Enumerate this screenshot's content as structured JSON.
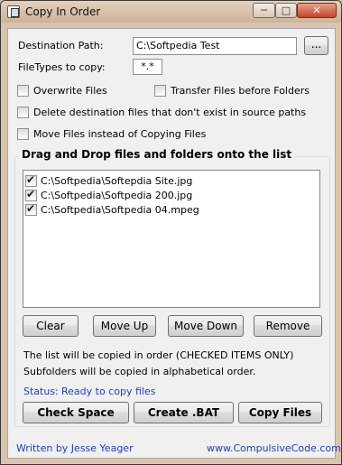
{
  "window": {
    "title": "Copy In Order",
    "minimize_glyph": "─",
    "maximize_glyph": "□",
    "close_glyph": "✕"
  },
  "destination": {
    "label": "Destination Path:",
    "value": "C:\\Softpedia Test",
    "browse_label": "..."
  },
  "filetypes": {
    "label": "FileTypes to copy:",
    "value": "*.*"
  },
  "options": {
    "overwrite": {
      "label": "Overwrite Files",
      "checked": false
    },
    "transfer_before_folders": {
      "label": "Transfer Files before Folders",
      "checked": false
    },
    "delete_destination": {
      "label": "Delete destination files that don't exist in source paths",
      "checked": false
    },
    "move_files": {
      "label": "Move Files instead of Copying Files",
      "checked": false
    }
  },
  "dropgroup": {
    "title": "Drag and Drop files and folders onto the list",
    "items": [
      {
        "path": "C:\\Softpedia\\Softepdia Site.jpg",
        "checked": true
      },
      {
        "path": "C:\\Softpedia\\Softpedia 200.jpg",
        "checked": true
      },
      {
        "path": "C:\\Softpedia\\Softpedia 04.mpeg",
        "checked": true
      }
    ],
    "buttons": {
      "clear": "Clear",
      "move_up": "Move Up",
      "move_down": "Move Down",
      "remove": "Remove"
    },
    "note1": "The list will be copied in order (CHECKED ITEMS ONLY)",
    "note2": "Subfolders will be copied in alphabetical order.",
    "status_label": "Status:",
    "status_value": "Ready to copy files",
    "actions": {
      "check_space": "Check Space",
      "create_bat": "Create .BAT",
      "copy_files": "Copy Files"
    }
  },
  "footer": {
    "author": "Written by Jesse Yeager",
    "website": "www.CompulsiveCode.com"
  },
  "colors": {
    "accent_blue": "#1f3fbf",
    "window_frame": "#d9c4ad",
    "close_red": "#c8452c"
  },
  "icons": {
    "app": "app-icon",
    "checkbox_checked": "check-mark-icon"
  }
}
